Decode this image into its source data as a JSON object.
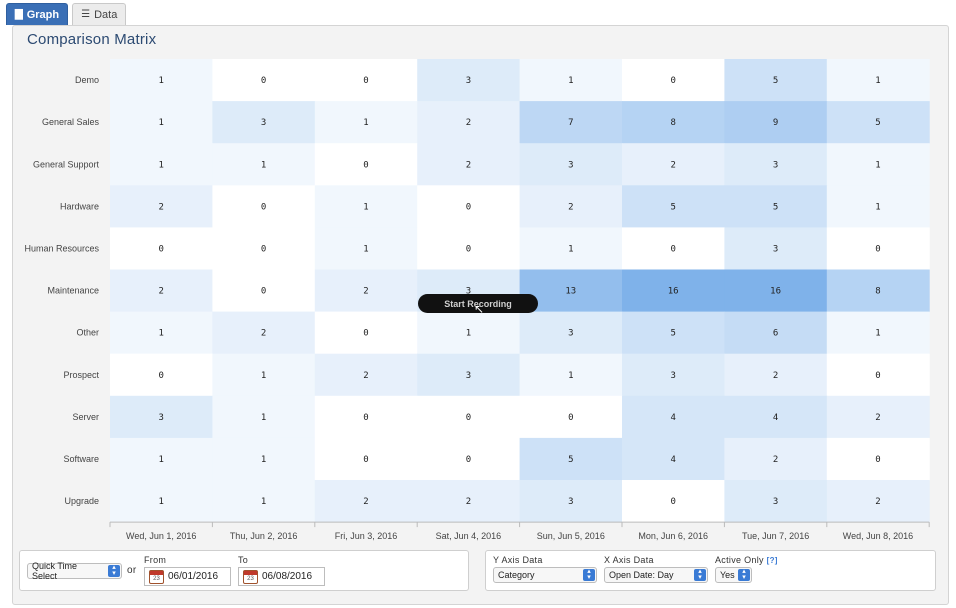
{
  "tabs": [
    {
      "label": "Graph",
      "icon": "bar-chart-icon",
      "active": true
    },
    {
      "label": "Data",
      "icon": "list-icon",
      "active": false
    }
  ],
  "panel": {
    "title": "Comparison Matrix"
  },
  "chart_data": {
    "type": "heatmap",
    "title": "Comparison Matrix",
    "rows": [
      "Demo",
      "General Sales",
      "General Support",
      "Hardware",
      "Human Resources",
      "Maintenance",
      "Other",
      "Prospect",
      "Server",
      "Software",
      "Upgrade"
    ],
    "columns": [
      "Wed, Jun 1, 2016",
      "Thu, Jun 2, 2016",
      "Fri, Jun 3, 2016",
      "Sat, Jun 4, 2016",
      "Sun, Jun 5, 2016",
      "Mon, Jun 6, 2016",
      "Tue, Jun 7, 2016",
      "Wed, Jun 8, 2016"
    ],
    "values": [
      [
        1,
        0,
        0,
        3,
        1,
        0,
        5,
        1
      ],
      [
        1,
        3,
        1,
        2,
        7,
        8,
        9,
        5
      ],
      [
        1,
        1,
        0,
        2,
        3,
        2,
        3,
        1
      ],
      [
        2,
        0,
        1,
        0,
        2,
        5,
        5,
        1
      ],
      [
        0,
        0,
        1,
        0,
        1,
        0,
        3,
        0
      ],
      [
        2,
        0,
        2,
        3,
        13,
        16,
        16,
        8
      ],
      [
        1,
        2,
        0,
        1,
        3,
        5,
        6,
        1
      ],
      [
        0,
        1,
        2,
        3,
        1,
        3,
        2,
        0
      ],
      [
        3,
        1,
        0,
        0,
        0,
        4,
        4,
        2
      ],
      [
        1,
        1,
        0,
        0,
        5,
        4,
        2,
        0
      ],
      [
        1,
        1,
        2,
        2,
        3,
        0,
        3,
        2
      ]
    ],
    "color_low": "#ffffff",
    "color_high": "#7fb2ea",
    "max_value": 16
  },
  "overlay": {
    "record_label": "Start Recording"
  },
  "controls": {
    "quick_time": "Quick Time Select",
    "or_label": "or",
    "from_label": "From",
    "from_value": "06/01/2016",
    "to_label": "To",
    "to_value": "06/08/2016",
    "cal_day": "23",
    "y_axis_label": "Y Axis Data",
    "y_axis_value": "Category",
    "x_axis_label": "X Axis Data",
    "x_axis_value": "Open Date: Day",
    "active_only_label": "Active Only",
    "help_label": "[?]",
    "active_only_value": "Yes"
  }
}
